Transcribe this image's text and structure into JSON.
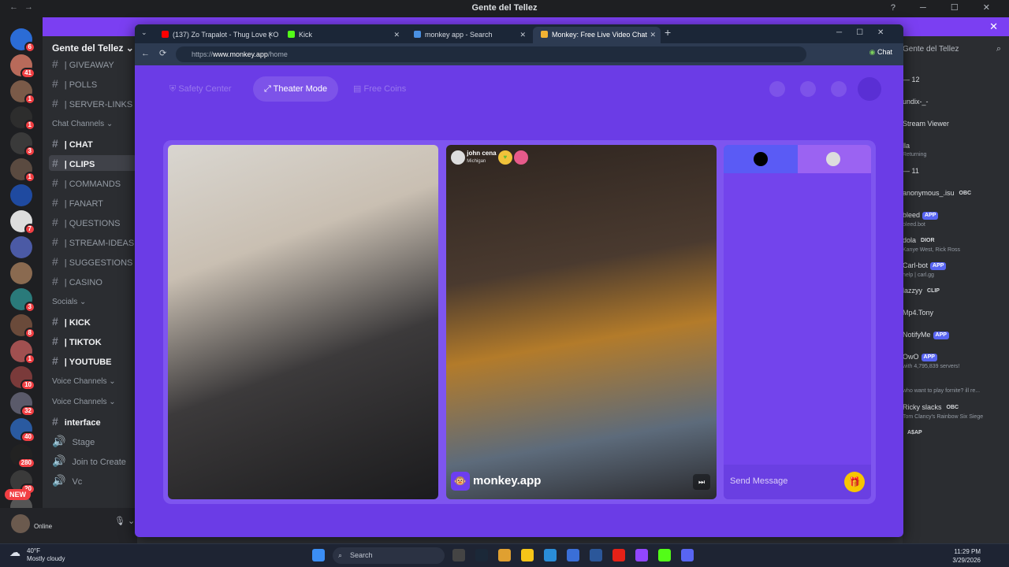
{
  "window": {
    "title": "Gente del Tellez"
  },
  "discord": {
    "guild_name": "Gente del Tellez",
    "server_badges": [
      "6",
      "41",
      "1",
      "1",
      "3",
      "1",
      "",
      "7",
      "",
      "",
      "3",
      "8",
      "1",
      "10",
      "32",
      "40",
      "280",
      "20",
      ""
    ],
    "new_badge": "NEW",
    "channels": [
      {
        "name": "| GIVEAWAY",
        "bold": false
      },
      {
        "name": "| POLLS",
        "bold": false
      },
      {
        "name": "| SERVER-LINKS",
        "bold": false
      },
      {
        "category": "Chat Channels"
      },
      {
        "name": "| CHAT",
        "bold": true
      },
      {
        "name": "| CLIPS",
        "bold": true,
        "active": true
      },
      {
        "name": "| COMMANDS",
        "bold": false
      },
      {
        "name": "| FANART",
        "bold": false
      },
      {
        "name": "| QUESTIONS",
        "bold": false
      },
      {
        "name": "| STREAM-IDEAS",
        "bold": false
      },
      {
        "name": "| SUGGESTIONS",
        "bold": false
      },
      {
        "name": "| CASINO",
        "bold": false
      },
      {
        "category": "Socials"
      },
      {
        "name": "| KICK",
        "bold": true
      },
      {
        "name": "| TIKTOK",
        "bold": true
      },
      {
        "name": "| YOUTUBE",
        "bold": true
      },
      {
        "category": "Voice Channels"
      },
      {
        "category": "Voice Channels"
      },
      {
        "name": "interface",
        "bold": true
      },
      {
        "voice": "Stage"
      },
      {
        "voice": "Join to Create"
      },
      {
        "voice": "Vc"
      }
    ],
    "user_status": "Online",
    "members_header": "Gente del Tellez",
    "members": [
      {
        "name": "— 12",
        "sub": ""
      },
      {
        "name": "undix-_-",
        "sub": ""
      },
      {
        "name": "Stream Viewer",
        "sub": ""
      },
      {
        "name": "lla",
        "sub": "Returning"
      },
      {
        "name": "— 11",
        "sub": ""
      },
      {
        "name": "anonymous_.isu",
        "tag": "OBC",
        "sub": ""
      },
      {
        "name": "bleed",
        "tag": "APP",
        "sub": "bleed.bot"
      },
      {
        "name": "dola",
        "tag": "DIOR",
        "sub": "Kanye West, Rick Ross"
      },
      {
        "name": "Carl-bot",
        "tag": "APP",
        "sub": "help | carl.gg"
      },
      {
        "name": "lazzyy",
        "tag": "CLIP",
        "sub": ""
      },
      {
        "name": "Mp4.Tony",
        "sub": ""
      },
      {
        "name": "NotifyMe",
        "tag": "APP",
        "sub": ""
      },
      {
        "name": "OwO",
        "tag": "APP",
        "sub": "with 4,795,839 servers!"
      },
      {
        "name": "",
        "sub": "who want to play fornite? ill re..."
      },
      {
        "name": "Ricky slacks",
        "tag": "OBC",
        "sub": "Tom Clancy's Rainbow Six Siege"
      },
      {
        "name": "",
        "tag": "A$AP",
        "sub": ""
      }
    ]
  },
  "browser": {
    "tabs": [
      {
        "label": "(137) Zo Trapalot - Thug Love ( Of",
        "color": "#ff0000"
      },
      {
        "label": "Kick",
        "color": "#53fc18"
      },
      {
        "label": "monkey app - Search",
        "color": "#4a90e2"
      },
      {
        "label": "Monkey: Free Live Video Chat",
        "color": "#f2b233",
        "active": true
      }
    ],
    "url_prefix": "https://",
    "url_domain": "www.monkey.app",
    "url_path": "/home",
    "chat_label": "Chat"
  },
  "monkey": {
    "nav": {
      "safety": "Safety Center",
      "theater": "Theater Mode",
      "coins": "Free Coins"
    },
    "partner_name": "john cena",
    "partner_location": "Michigan",
    "logo_text": "monkey.app",
    "send_placeholder": "Send Message"
  },
  "taskbar": {
    "weather_temp": "40°F",
    "weather_desc": "Mostly cloudy",
    "search": "Search",
    "time": "11:29 PM",
    "date": "3/29/2026"
  },
  "colors": {
    "accent": "#7b3ff2",
    "page_bg": "#6b3ce6"
  }
}
